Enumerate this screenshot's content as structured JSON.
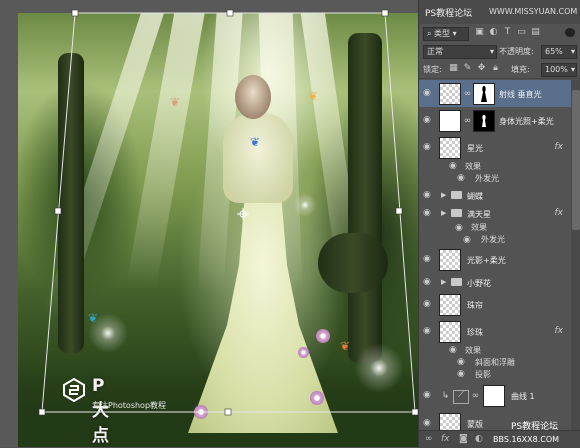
{
  "watermark": {
    "brand": "P大点S",
    "subtitle": "专注Photoshop教程"
  },
  "site_banner": {
    "title": "PS教程论坛",
    "url": "WWW.MISSYUAN.COM"
  },
  "layers_panel": {
    "filter_kind": "类型",
    "blend_mode": "正常",
    "opacity_label": "不透明度:",
    "opacity_value": "65%",
    "lock_label": "锁定:",
    "fill_label": "填充:",
    "fill_value": "100%",
    "layers": [
      {
        "name": "射线 垂直光",
        "selected": true
      },
      {
        "name": "身体光照+柔光"
      },
      {
        "name": "星光",
        "fx": "fx",
        "effects_label": "效果",
        "effects": [
          "外发光"
        ]
      },
      {
        "name": "蝴蝶",
        "type": "group"
      },
      {
        "name": "满天星",
        "type": "group",
        "fx": "fx",
        "effects_label": "效果",
        "effects": [
          "外发光"
        ]
      },
      {
        "name": "光影+柔光"
      },
      {
        "name": "小野花",
        "type": "group"
      },
      {
        "name": "珠帘"
      },
      {
        "name": "珍珠",
        "fx": "fx",
        "effects_label": "效果",
        "effects": [
          "斜面和浮雕",
          "投影"
        ]
      },
      {
        "name": "曲线 1",
        "type": "adjustment"
      },
      {
        "name": "蒙版"
      }
    ],
    "footer_site": "PS教程论坛",
    "footer_url": "BBS.16XX8.COM"
  },
  "icons": {
    "visibility": "eye-icon",
    "fx": "fx-icon",
    "group": "folder-icon",
    "link": "chain-link-icon",
    "lock": "lock-icon"
  }
}
